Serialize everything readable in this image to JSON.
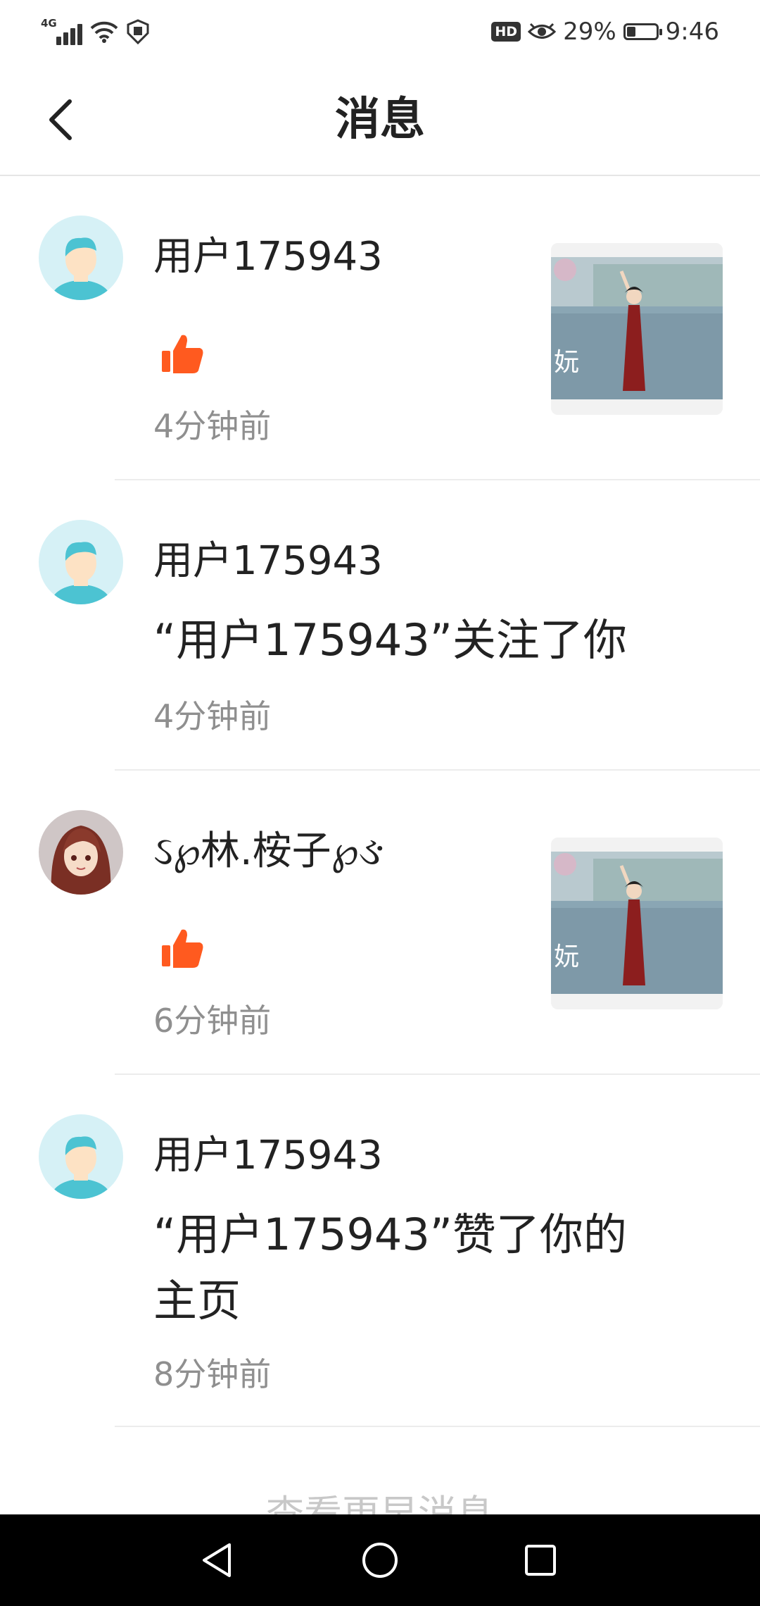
{
  "status_bar": {
    "network_label": "4G",
    "battery_percent": "29%",
    "battery_level": 0.29,
    "time": "9:46",
    "hd_label": "HD",
    "icons": [
      "signal-icon",
      "wifi-icon",
      "shield-icon",
      "hd-icon",
      "eye-icon",
      "battery-icon"
    ]
  },
  "header": {
    "title": "消息",
    "back_icon": "chevron-left-icon"
  },
  "messages": [
    {
      "name": "用户175943",
      "text": "",
      "time": "4分钟前",
      "type": "like",
      "has_thumbnail": true,
      "thumb_caption": "妧"
    },
    {
      "name": "用户175943",
      "text": "“用户175943”关注了你",
      "time": "4分钟前",
      "type": "follow",
      "has_thumbnail": false
    },
    {
      "name": "ઽ℘林.桉子℘ઙ",
      "text": "",
      "time": "6分钟前",
      "type": "like",
      "has_thumbnail": true,
      "thumb_caption": "妧"
    },
    {
      "name": "用户175943",
      "text": "“用户175943”赞了你的主页",
      "time": "8分钟前",
      "type": "profile_like",
      "has_thumbnail": false
    }
  ],
  "footer": {
    "more_label": "查看更早消息"
  },
  "colors": {
    "like": "#ff5a1f",
    "avatar_bg": "#d6f1f6",
    "avatar_hair": "#4cc3d2",
    "divider": "#ececec",
    "time": "#8f8f8f"
  },
  "nav": {
    "items": [
      "back-triangle-icon",
      "home-circle-icon",
      "recents-square-icon"
    ]
  }
}
